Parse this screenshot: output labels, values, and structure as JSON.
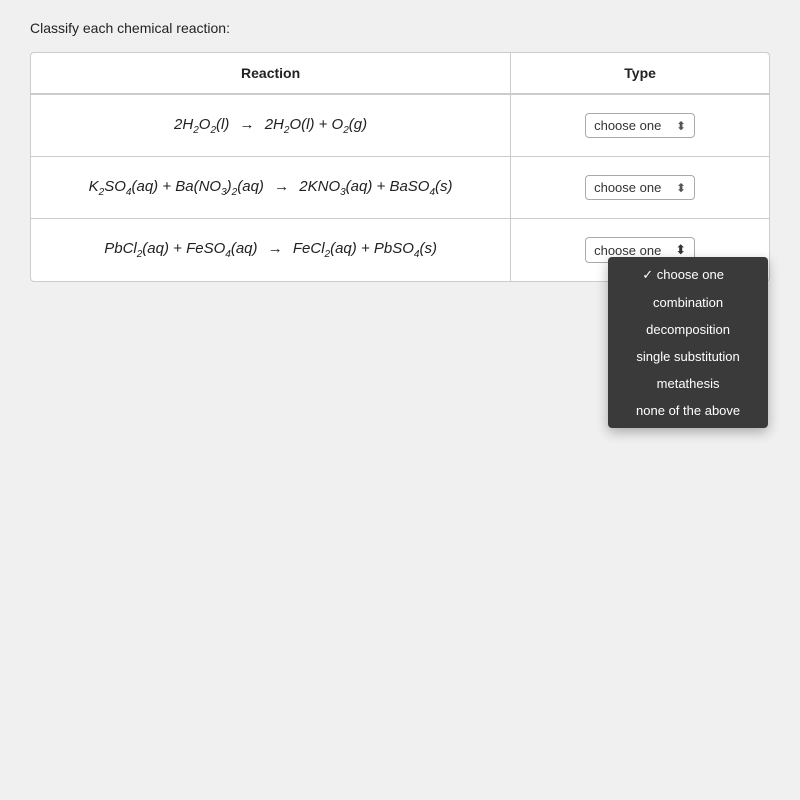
{
  "page": {
    "title": "Classify each chemical reaction:"
  },
  "table": {
    "header": {
      "reaction": "Reaction",
      "type": "Type"
    },
    "rows": [
      {
        "id": "row1",
        "reaction_html": "2H<sub>2</sub>O<sub>2</sub>(<i>l</i>) → 2H<sub>2</sub>O(<i>l</i>) + O<sub>2</sub>(<i>g</i>)",
        "select_value": "choose one",
        "dropdown_open": false
      },
      {
        "id": "row2",
        "reaction_html": "K<sub>2</sub>SO<sub>4</sub>(<i>aq</i>) + Ba(NO<sub>3</sub>)<sub>2</sub>(<i>aq</i>) → 2KNO<sub>3</sub>(<i>aq</i>) + BaSO<sub>4</sub>(<i>s</i>)",
        "select_value": "choose one",
        "dropdown_open": false
      },
      {
        "id": "row3",
        "reaction_html": "PbCl<sub>2</sub>(<i>aq</i>) + FeSO<sub>4</sub>(<i>aq</i>) → FeCl<sub>2</sub>(<i>aq</i>) + PbSO<sub>4</sub>(<i>s</i>)",
        "select_value": "choose one",
        "dropdown_open": true
      }
    ],
    "dropdown_options": [
      {
        "label": "choose one",
        "checked": true
      },
      {
        "label": "combination",
        "checked": false
      },
      {
        "label": "decomposition",
        "checked": false
      },
      {
        "label": "single substitution",
        "checked": false
      },
      {
        "label": "metathesis",
        "checked": false
      },
      {
        "label": "none of the above",
        "checked": false
      }
    ]
  }
}
